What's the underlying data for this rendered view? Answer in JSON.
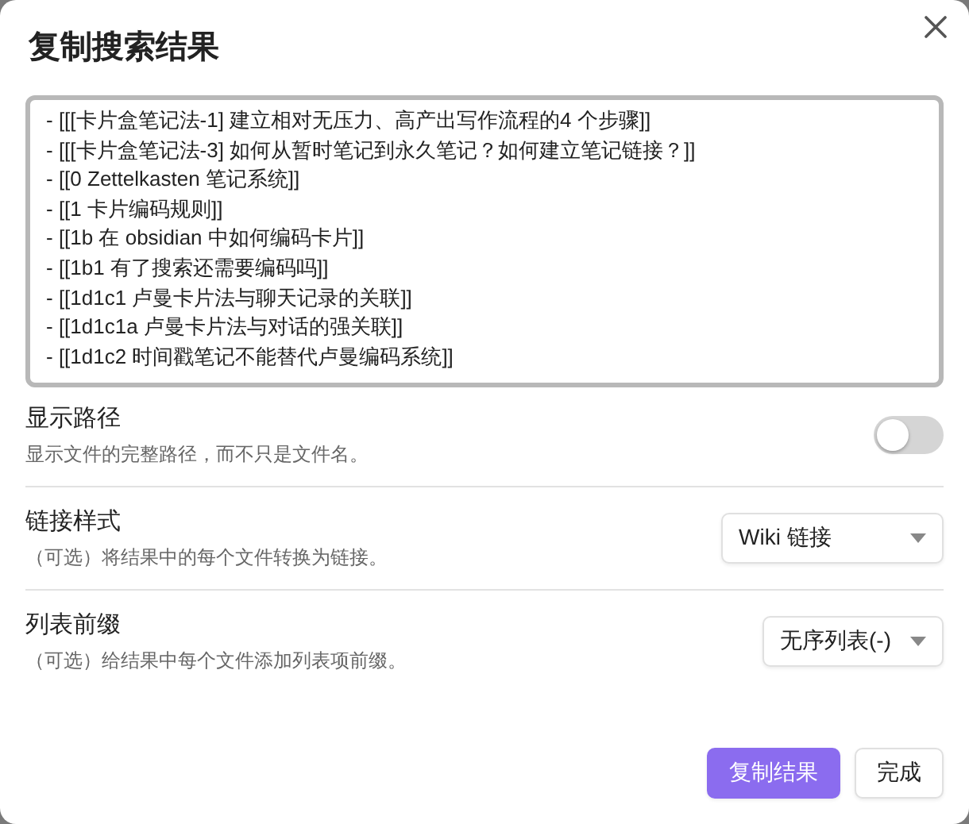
{
  "dialog": {
    "title": "复制搜索结果",
    "results_text": [
      "- [[[卡片盒笔记法-1] 建立相对无压力、高产出写作流程的4 个步骤]]",
      "- [[[卡片盒笔记法-3] 如何从暂时笔记到永久笔记？如何建立笔记链接？]]",
      "- [[0 Zettelkasten 笔记系统]]",
      "- [[1 卡片编码规则]]",
      "- [[1b 在 obsidian 中如何编码卡片]]",
      "- [[1b1 有了搜索还需要编码吗]]",
      "- [[1d1c1 卢曼卡片法与聊天记录的关联]]",
      "- [[1d1c1a 卢曼卡片法与对话的强关联]]",
      "- [[1d1c2 时间戳笔记不能替代卢曼编码系统]]"
    ],
    "settings": [
      {
        "kind": "toggle",
        "name": "显示路径",
        "description": "显示文件的完整路径，而不只是文件名。",
        "on": false
      },
      {
        "kind": "dropdown",
        "name": "链接样式",
        "description": "（可选）将结果中的每个文件转换为链接。",
        "value": "Wiki 链接"
      },
      {
        "kind": "dropdown",
        "name": "列表前缀",
        "description": "（可选）给结果中每个文件添加列表项前缀。",
        "value": "无序列表(-)"
      }
    ],
    "buttons": [
      {
        "label": "复制结果",
        "primary": true
      },
      {
        "label": "完成",
        "primary": false
      }
    ]
  }
}
